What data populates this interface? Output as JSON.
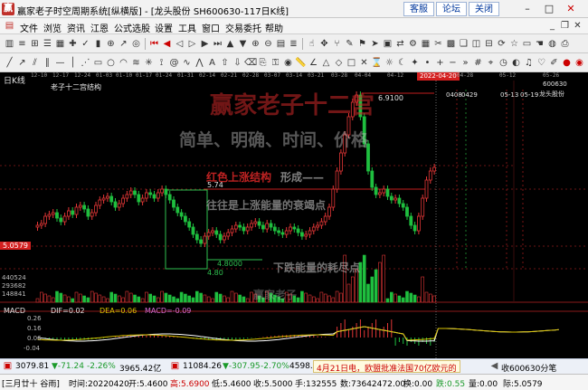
{
  "window": {
    "title": "赢家老子时空周期系统[纵横版] - [龙头股份  SH600630-117日K线]",
    "top_buttons": [
      "客服",
      "论坛",
      "关闭"
    ]
  },
  "menu": {
    "items": [
      "文件",
      "浏览",
      "资讯",
      "江恩",
      "公式选股",
      "设置",
      "工具",
      "窗口",
      "交易委托",
      "帮助"
    ]
  },
  "ruler": {
    "ticks": [
      "12-10",
      "12-17",
      "12-24",
      "01-03",
      "01-10",
      "01-17",
      "01-24",
      "01-31",
      "02-14",
      "02-21",
      "02-28",
      "03-07",
      "03-14",
      "03-21",
      "03-28",
      "04-04",
      "04-12",
      "04-28",
      "05-12",
      "05-26"
    ],
    "highlight": "2022-04-20"
  },
  "chart": {
    "period_label": "日K线",
    "indicator_label": "老子十二宫结构",
    "stock_code": "600630",
    "stock_name": "龙头股份",
    "current_price_tag": "5.0579",
    "price_high": "6.9100",
    "price_level_1": "5.74",
    "price_level_2": "4.8000",
    "price_level_3": "4.80",
    "dates_top": [
      "0408",
      "0429",
      "05-13",
      "05-19"
    ],
    "volume_labels": [
      "4405​24",
      "293682",
      "148841"
    ],
    "watermark_brand": "赢家老子十二宫",
    "watermark_slogan": "简单、明确、时间、价格",
    "note_red": "红色上涨结构",
    "note_red_suffix": "形成——",
    "note_line_2": "往往是上涨能量的衰竭点",
    "note_line_3": "下跌能量的耗尽点",
    "note_line_4": "赢家老子"
  },
  "macd": {
    "name": "MACD",
    "dif": "DIF=0.02",
    "dea": "DEA=0.06",
    "macd": "MACD=-0.09",
    "ticks": [
      "0.26",
      "0.16",
      "0.06",
      "-0.04"
    ]
  },
  "index_bar": {
    "sh_value": "3079.81",
    "sh_change": "▼-71.24",
    "sh_pct": "-2.26%",
    "sh_amount": "3965.42亿",
    "sz_value": "11084.26",
    "sz_change": "▼-307.95",
    "sz_pct": "-2.70%",
    "sz_amount": "4598.1",
    "news": "4月21日电，欧盟批准法国70亿欧元的",
    "minute_label": "收600630分笔"
  },
  "bottom_bar": {
    "date_label": "[三月廿十 谷雨]",
    "time": "时间:20220420",
    "open": "开:5.4600",
    "high": "高:5.6900",
    "low": "低:5.4600",
    "close": "收:5.5000",
    "hand": "手:132555",
    "amount": "数:73642472.00",
    "change_rate": "换:0.00",
    "pct": "跌:0.55",
    "amplitude": "量:0.00",
    "last": "际:5.0579"
  },
  "colors": {
    "rise": "#e23636",
    "fall": "#1fbf3f",
    "dif_line": "#ffffff",
    "dea_line": "#d9c200",
    "grid_red": "#7a1212"
  }
}
